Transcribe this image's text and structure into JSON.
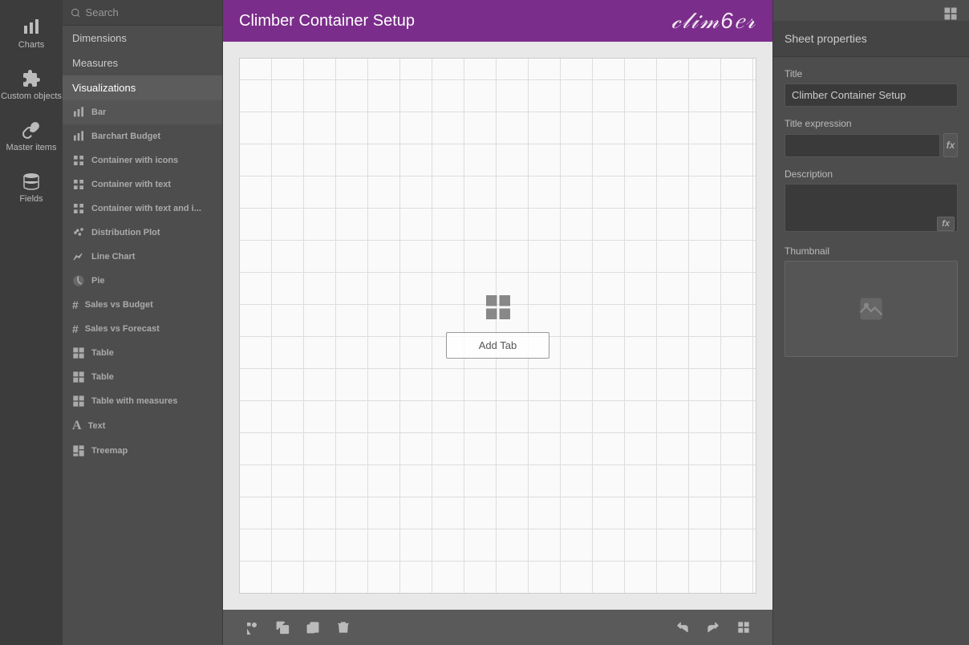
{
  "iconSidebar": {
    "items": [
      {
        "id": "charts",
        "label": "Charts",
        "icon": "chart-bar"
      },
      {
        "id": "custom-objects",
        "label": "Custom objects",
        "icon": "puzzle"
      },
      {
        "id": "master-items",
        "label": "Master items",
        "icon": "link"
      },
      {
        "id": "fields",
        "label": "Fields",
        "icon": "database"
      }
    ]
  },
  "panel": {
    "searchPlaceholder": "Search",
    "sections": [
      {
        "id": "dimensions",
        "label": "Dimensions"
      },
      {
        "id": "measures",
        "label": "Measures"
      },
      {
        "id": "visualizations",
        "label": "Visualizations",
        "active": true
      }
    ],
    "items": [
      {
        "id": "bar",
        "label": "Bar",
        "icon": "barchart"
      },
      {
        "id": "barchart-budget",
        "label": "Barchart Budget",
        "icon": "barchart"
      },
      {
        "id": "container-icons",
        "label": "Container with icons",
        "icon": "grid"
      },
      {
        "id": "container-text",
        "label": "Container with text",
        "icon": "grid"
      },
      {
        "id": "container-text-and",
        "label": "Container with text and i...",
        "icon": "grid"
      },
      {
        "id": "distribution-plot",
        "label": "Distribution Plot",
        "icon": "distribution"
      },
      {
        "id": "line-chart",
        "label": "Line Chart",
        "icon": "linechart"
      },
      {
        "id": "pie",
        "label": "Pie",
        "icon": "pie"
      },
      {
        "id": "sales-vs-budget",
        "label": "Sales vs Budget",
        "icon": "hash"
      },
      {
        "id": "sales-vs-forecast",
        "label": "Sales vs Forecast",
        "icon": "hash"
      },
      {
        "id": "table1",
        "label": "Table",
        "icon": "grid"
      },
      {
        "id": "table2",
        "label": "Table",
        "icon": "grid"
      },
      {
        "id": "table-measures",
        "label": "Table with measures",
        "icon": "grid"
      },
      {
        "id": "text",
        "label": "Text",
        "icon": "text-a"
      },
      {
        "id": "treemap",
        "label": "Treemap",
        "icon": "grid"
      }
    ]
  },
  "mainHeader": {
    "title": "Climber Container Setup",
    "logo": "climber"
  },
  "canvas": {
    "addTabLabel": "Add Tab"
  },
  "rightPanel": {
    "title": "Sheet properties",
    "fields": {
      "titleLabel": "Title",
      "titleValue": "Climber Container Setup",
      "titleExpressionLabel": "Title expression",
      "titleExpressionValue": "",
      "descriptionLabel": "Description",
      "descriptionValue": "",
      "thumbnailLabel": "Thumbnail"
    },
    "fxLabel": "fx"
  },
  "bottomToolbar": {
    "buttons": [
      {
        "id": "shapes",
        "label": "shapes"
      },
      {
        "id": "copy",
        "label": "copy"
      },
      {
        "id": "paste",
        "label": "paste"
      },
      {
        "id": "delete",
        "label": "delete"
      },
      {
        "id": "undo",
        "label": "undo"
      },
      {
        "id": "redo",
        "label": "redo"
      },
      {
        "id": "expand",
        "label": "expand"
      }
    ]
  }
}
